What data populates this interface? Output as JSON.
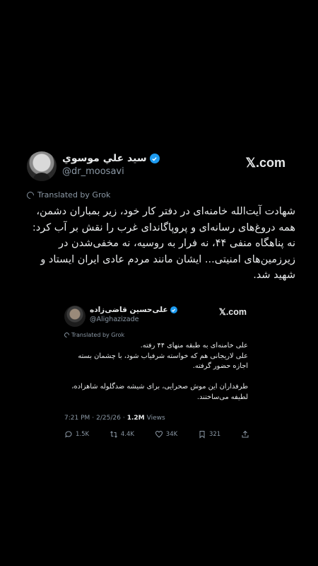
{
  "tweet": {
    "author": {
      "display_name": "سيد علي موسوي",
      "handle": "@dr_moosavi"
    },
    "brand": "𝕏.com",
    "translated_label": "Translated by Grok",
    "text_lines": [
      "شهادت آیت‌الله خامنه‌ای در دفتر کار خود، زیر بمباران دشمن،",
      "همه دروغ‌های رسانه‌ای و پروپاگاندای غرب را نقش بر آب کرد:",
      "نه پناهگاه منفی ۴۴، نه فرار به روسیه، نه مخفی‌شدن در",
      "زیرزمین‌های امنیتی... ایشان مانند مردم عادی ایران ایستاد و",
      "شهید شد."
    ]
  },
  "quote": {
    "author": {
      "display_name": "علی‌حسین قاضی‌زاده",
      "handle": "@Alighazizade"
    },
    "brand": "𝕏.com",
    "translated_label": "Translated by Grok",
    "text_lines": [
      "علی خامنه‌ای به طبقه منهای ۴۴ رفته.",
      "علی لاریجانی هم که خواسته شرفیاب شود، با چشمان بسته",
      "اجازه حضور گرفته.",
      "",
      "طرفداران این موش صحرایی، برای شیشه ضدگلوله شاهزاده،",
      "لطیفه می‌ساختند."
    ],
    "meta": {
      "time": "7:21 PM",
      "date": "2/25/26",
      "views_count": "1.2M",
      "views_label": "Views"
    },
    "actions": {
      "replies": "1.5K",
      "reposts": "4.4K",
      "likes": "34K",
      "bookmarks": "321"
    }
  },
  "colors": {
    "background": "#000000",
    "text": "#e7e9ea",
    "muted": "#8b98a5",
    "verified": "#1d9bf0"
  }
}
